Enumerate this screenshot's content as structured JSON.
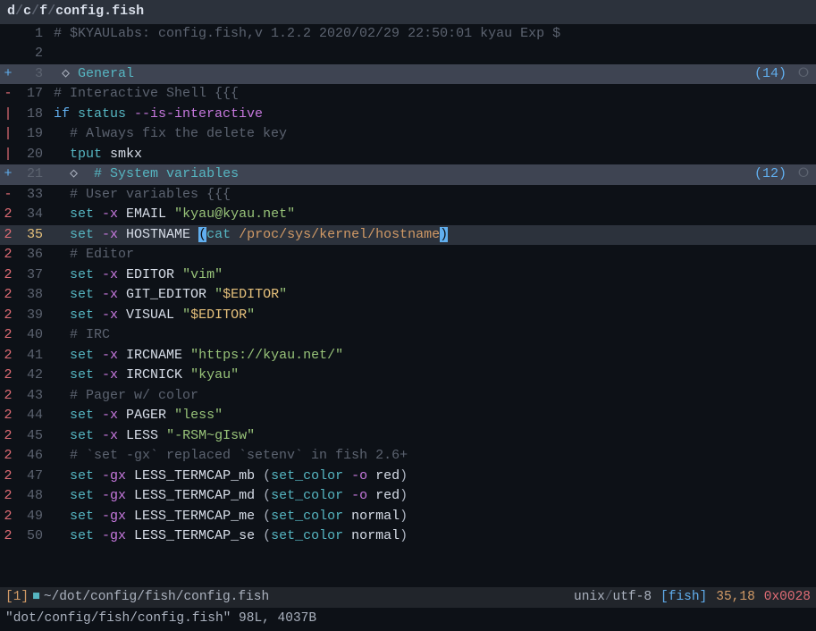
{
  "titlebar": {
    "path": "d/c/f/config.fish",
    "parts": [
      "d",
      "c",
      "f",
      "config.fish"
    ]
  },
  "lines": [
    {
      "fold": "",
      "num": "1",
      "current": false,
      "hl": false,
      "foldhdr": false,
      "tokens": [
        [
          "c-comment",
          "# $KYAULabs: config.fish,v 1.2.2 2020/02/29 22:50:01 kyau Exp $"
        ]
      ]
    },
    {
      "fold": "",
      "num": "2",
      "current": false,
      "hl": false,
      "foldhdr": false,
      "tokens": []
    },
    {
      "fold": "+",
      "num": "3",
      "current": false,
      "hl": false,
      "foldhdr": true,
      "foldcount": "(14)",
      "tokens": [
        [
          "c-diamond",
          " ◇ "
        ],
        [
          "c-cyan",
          "General"
        ]
      ]
    },
    {
      "fold": "-",
      "num": "17",
      "current": false,
      "hl": false,
      "foldhdr": false,
      "tokens": [
        [
          "c-comment",
          "# Interactive Shell {{{"
        ]
      ]
    },
    {
      "fold": "|",
      "num": "18",
      "current": false,
      "hl": false,
      "foldhdr": false,
      "tokens": [
        [
          "c-keyword",
          "if "
        ],
        [
          "c-builtin",
          "status "
        ],
        [
          "c-option",
          "--is-interactive"
        ]
      ]
    },
    {
      "fold": "|",
      "num": "19",
      "current": false,
      "hl": false,
      "foldhdr": false,
      "tokens": [
        [
          "",
          "  "
        ],
        [
          "c-comment",
          "# Always fix the delete key"
        ]
      ]
    },
    {
      "fold": "|",
      "num": "20",
      "current": false,
      "hl": false,
      "foldhdr": false,
      "tokens": [
        [
          "",
          "  "
        ],
        [
          "c-builtin",
          "tput "
        ],
        [
          "c-white",
          "smkx"
        ]
      ]
    },
    {
      "fold": "+",
      "num": "21",
      "current": false,
      "hl": false,
      "foldhdr": true,
      "foldcount": "(12)",
      "tokens": [
        [
          "c-diamond",
          "  ◇  "
        ],
        [
          "c-cyan",
          "# System variables"
        ]
      ]
    },
    {
      "fold": "-",
      "num": "33",
      "current": false,
      "hl": false,
      "foldhdr": false,
      "tokens": [
        [
          "",
          "  "
        ],
        [
          "c-comment",
          "# User variables {{{"
        ]
      ]
    },
    {
      "fold": "2",
      "num": "34",
      "current": false,
      "hl": false,
      "foldhdr": false,
      "tokens": [
        [
          "",
          "  "
        ],
        [
          "c-builtin",
          "set "
        ],
        [
          "c-option",
          "-x "
        ],
        [
          "c-white",
          "EMAIL "
        ],
        [
          "c-string",
          "\"kyau@kyau.net\""
        ]
      ]
    },
    {
      "fold": "2",
      "num": "35",
      "current": true,
      "hl": true,
      "foldhdr": false,
      "tokens": [
        [
          "",
          "  "
        ],
        [
          "c-builtin",
          "set "
        ],
        [
          "c-option",
          "-x "
        ],
        [
          "c-white",
          "HOSTNAME "
        ],
        [
          "match-paren",
          "("
        ],
        [
          "c-func",
          "cat "
        ],
        [
          "c-path",
          "/proc/sys/kernel/hostname"
        ],
        [
          "match-paren",
          ")"
        ]
      ]
    },
    {
      "fold": "2",
      "num": "36",
      "current": false,
      "hl": false,
      "foldhdr": false,
      "tokens": [
        [
          "",
          "  "
        ],
        [
          "c-comment",
          "# Editor"
        ]
      ]
    },
    {
      "fold": "2",
      "num": "37",
      "current": false,
      "hl": false,
      "foldhdr": false,
      "tokens": [
        [
          "",
          "  "
        ],
        [
          "c-builtin",
          "set "
        ],
        [
          "c-option",
          "-x "
        ],
        [
          "c-white",
          "EDITOR "
        ],
        [
          "c-string",
          "\"vim\""
        ]
      ]
    },
    {
      "fold": "2",
      "num": "38",
      "current": false,
      "hl": false,
      "foldhdr": false,
      "tokens": [
        [
          "",
          "  "
        ],
        [
          "c-builtin",
          "set "
        ],
        [
          "c-option",
          "-x "
        ],
        [
          "c-white",
          "GIT_EDITOR "
        ],
        [
          "c-string",
          "\""
        ],
        [
          "c-var",
          "$EDITOR"
        ],
        [
          "c-string",
          "\""
        ]
      ]
    },
    {
      "fold": "2",
      "num": "39",
      "current": false,
      "hl": false,
      "foldhdr": false,
      "tokens": [
        [
          "",
          "  "
        ],
        [
          "c-builtin",
          "set "
        ],
        [
          "c-option",
          "-x "
        ],
        [
          "c-white",
          "VISUAL "
        ],
        [
          "c-string",
          "\""
        ],
        [
          "c-var",
          "$EDITOR"
        ],
        [
          "c-string",
          "\""
        ]
      ]
    },
    {
      "fold": "2",
      "num": "40",
      "current": false,
      "hl": false,
      "foldhdr": false,
      "tokens": [
        [
          "",
          "  "
        ],
        [
          "c-comment",
          "# IRC"
        ]
      ]
    },
    {
      "fold": "2",
      "num": "41",
      "current": false,
      "hl": false,
      "foldhdr": false,
      "tokens": [
        [
          "",
          "  "
        ],
        [
          "c-builtin",
          "set "
        ],
        [
          "c-option",
          "-x "
        ],
        [
          "c-white",
          "IRCNAME "
        ],
        [
          "c-string",
          "\"https://kyau.net/\""
        ]
      ]
    },
    {
      "fold": "2",
      "num": "42",
      "current": false,
      "hl": false,
      "foldhdr": false,
      "tokens": [
        [
          "",
          "  "
        ],
        [
          "c-builtin",
          "set "
        ],
        [
          "c-option",
          "-x "
        ],
        [
          "c-white",
          "IRCNICK "
        ],
        [
          "c-string",
          "\"kyau\""
        ]
      ]
    },
    {
      "fold": "2",
      "num": "43",
      "current": false,
      "hl": false,
      "foldhdr": false,
      "tokens": [
        [
          "",
          "  "
        ],
        [
          "c-comment",
          "# Pager w/ color"
        ]
      ]
    },
    {
      "fold": "2",
      "num": "44",
      "current": false,
      "hl": false,
      "foldhdr": false,
      "tokens": [
        [
          "",
          "  "
        ],
        [
          "c-builtin",
          "set "
        ],
        [
          "c-option",
          "-x "
        ],
        [
          "c-white",
          "PAGER "
        ],
        [
          "c-string",
          "\"less\""
        ]
      ]
    },
    {
      "fold": "2",
      "num": "45",
      "current": false,
      "hl": false,
      "foldhdr": false,
      "tokens": [
        [
          "",
          "  "
        ],
        [
          "c-builtin",
          "set "
        ],
        [
          "c-option",
          "-x "
        ],
        [
          "c-white",
          "LESS "
        ],
        [
          "c-string",
          "\"-RSM~gIsw\""
        ]
      ]
    },
    {
      "fold": "2",
      "num": "46",
      "current": false,
      "hl": false,
      "foldhdr": false,
      "tokens": [
        [
          "",
          "  "
        ],
        [
          "c-comment",
          "# `set -gx` replaced `setenv` in fish 2.6+"
        ]
      ]
    },
    {
      "fold": "2",
      "num": "47",
      "current": false,
      "hl": false,
      "foldhdr": false,
      "tokens": [
        [
          "",
          "  "
        ],
        [
          "c-builtin",
          "set "
        ],
        [
          "c-option",
          "-gx "
        ],
        [
          "c-white",
          "LESS_TERMCAP_mb "
        ],
        [
          "c-paren",
          "("
        ],
        [
          "c-func",
          "set_color "
        ],
        [
          "c-option",
          "-o "
        ],
        [
          "c-white",
          "red"
        ],
        [
          "c-paren",
          ")"
        ]
      ]
    },
    {
      "fold": "2",
      "num": "48",
      "current": false,
      "hl": false,
      "foldhdr": false,
      "tokens": [
        [
          "",
          "  "
        ],
        [
          "c-builtin",
          "set "
        ],
        [
          "c-option",
          "-gx "
        ],
        [
          "c-white",
          "LESS_TERMCAP_md "
        ],
        [
          "c-paren",
          "("
        ],
        [
          "c-func",
          "set_color "
        ],
        [
          "c-option",
          "-o "
        ],
        [
          "c-white",
          "red"
        ],
        [
          "c-paren",
          ")"
        ]
      ]
    },
    {
      "fold": "2",
      "num": "49",
      "current": false,
      "hl": false,
      "foldhdr": false,
      "tokens": [
        [
          "",
          "  "
        ],
        [
          "c-builtin",
          "set "
        ],
        [
          "c-option",
          "-gx "
        ],
        [
          "c-white",
          "LESS_TERMCAP_me "
        ],
        [
          "c-paren",
          "("
        ],
        [
          "c-func",
          "set_color "
        ],
        [
          "c-white",
          "normal"
        ],
        [
          "c-paren",
          ")"
        ]
      ]
    },
    {
      "fold": "2",
      "num": "50",
      "current": false,
      "hl": false,
      "foldhdr": false,
      "tokens": [
        [
          "",
          "  "
        ],
        [
          "c-builtin",
          "set "
        ],
        [
          "c-option",
          "-gx "
        ],
        [
          "c-white",
          "LESS_TERMCAP_se "
        ],
        [
          "c-paren",
          "("
        ],
        [
          "c-func",
          "set_color "
        ],
        [
          "c-white",
          "normal"
        ],
        [
          "c-paren",
          ")"
        ]
      ]
    }
  ],
  "statusline": {
    "bufnum": "[1]",
    "modified": "■",
    "path": "~/dot/config/fish/config.fish",
    "encoding_parts": [
      "unix",
      "utf-8"
    ],
    "filetype": "[fish]",
    "position": "35,18",
    "hex": "0x0028"
  },
  "cmdline": "\"dot/config/fish/config.fish\" 98L, 4037B"
}
